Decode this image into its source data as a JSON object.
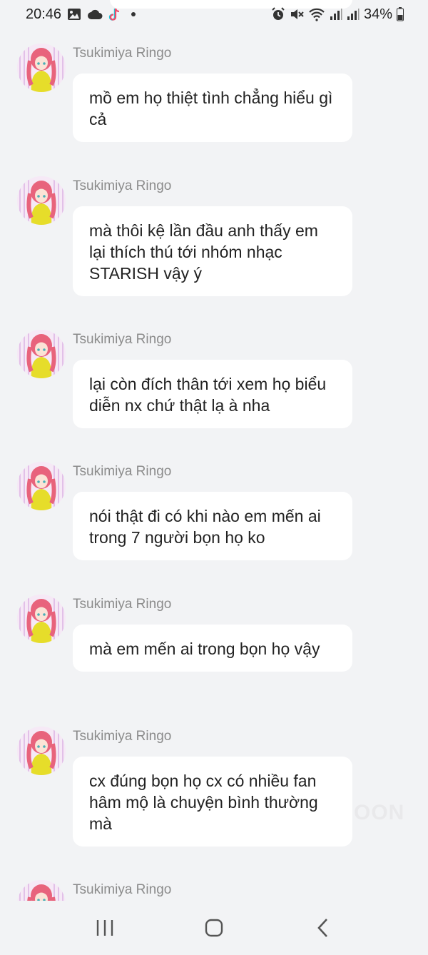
{
  "status_bar": {
    "time": "20:46",
    "battery": "34%",
    "icons": [
      "image-icon",
      "cloud-icon",
      "tiktok-icon",
      "alarm-icon",
      "mute-icon",
      "wifi-icon",
      "signal-icon",
      "signal-icon",
      "battery-icon"
    ]
  },
  "chat": {
    "messages": [
      {
        "sender": "Tsukimiya Ringo",
        "text": "mồ em họ thiệt tình chẳng hiểu gì cả"
      },
      {
        "sender": "Tsukimiya Ringo",
        "text": "mà thôi kệ lần đầu anh thấy em lại thích thú tới nhóm nhạc STARISH vậy ý"
      },
      {
        "sender": "Tsukimiya Ringo",
        "text": "lại còn đích thân tới xem họ biểu diễn nx chứ thật lạ à nha"
      },
      {
        "sender": "Tsukimiya Ringo",
        "text": "nói thật đi có khi nào em mến ai trong 7 người bọn họ ko"
      },
      {
        "sender": "Tsukimiya Ringo",
        "text": "mà em mến ai trong bọn họ vậy"
      },
      {
        "sender": "Tsukimiya Ringo",
        "text": "cx đúng bọn họ cx có nhiều fan hâm mộ là chuyện bình thường mà"
      },
      {
        "sender": "Tsukimiya Ringo",
        "text": ""
      }
    ],
    "watermark": "OON"
  },
  "nav_bar": {
    "buttons": [
      "recent-apps",
      "home",
      "back"
    ]
  },
  "colors": {
    "background": "#f2f3f5",
    "bubble": "#ffffff",
    "sender": "#8b8b8b",
    "avatar_hair": "#e8607a",
    "avatar_sweater": "#e8e02a"
  }
}
